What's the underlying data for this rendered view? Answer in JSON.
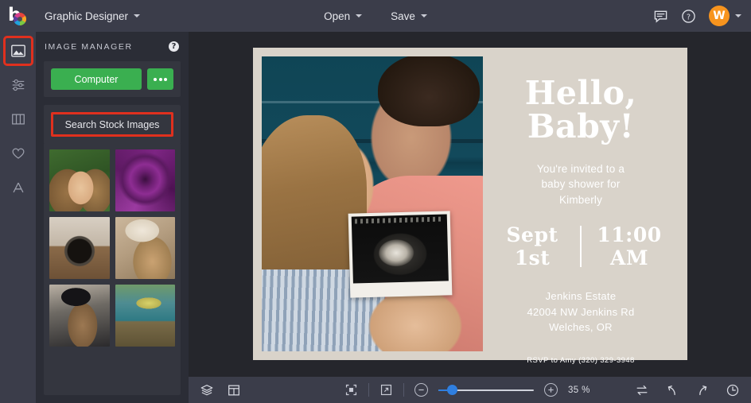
{
  "app": {
    "logo": "befunky-logo",
    "document_title": "Graphic Designer",
    "open_label": "Open",
    "save_label": "Save",
    "avatar_initial": "W",
    "accent_green": "#3aaf50",
    "accent_orange": "#f7941e",
    "highlight_red": "#e0301e",
    "accent_blue": "#2f7fe0"
  },
  "rail": {
    "items": [
      {
        "name": "image-manager",
        "icon": "image-icon",
        "active": true
      },
      {
        "name": "edit",
        "icon": "sliders-icon",
        "active": false
      },
      {
        "name": "templates",
        "icon": "columns-icon",
        "active": false
      },
      {
        "name": "favorites",
        "icon": "heart-icon",
        "active": false
      },
      {
        "name": "text",
        "icon": "text-a-icon",
        "active": false
      }
    ]
  },
  "panel": {
    "title": "IMAGE MANAGER",
    "help_icon": "question-icon",
    "computer_label": "Computer",
    "more_icon": "ellipsis-icon",
    "search_stock_label": "Search Stock Images",
    "thumbnails": [
      {
        "name": "thumb-woman-smiling",
        "class": "th1"
      },
      {
        "name": "thumb-purple-flower",
        "class": "th2"
      },
      {
        "name": "thumb-vintage-camera",
        "class": "th3"
      },
      {
        "name": "thumb-woman-hat-blonde",
        "class": "th4"
      },
      {
        "name": "thumb-woman-black-hat",
        "class": "th5"
      },
      {
        "name": "thumb-vintage-truck",
        "class": "th6"
      }
    ]
  },
  "canvas": {
    "card_bg": "#d9d3ca",
    "photo_alt": "couple-holding-ultrasound-photo",
    "headline_line1": "Hello,",
    "headline_line2": "Baby!",
    "invitation_text": "You're invited to a\nbaby shower for\nKimberly",
    "date_line1": "Sept",
    "date_line2": "1st",
    "time_line1": "11:00",
    "time_line2": "AM",
    "venue_line1": "Jenkins Estate",
    "venue_line2": "42004 NW Jenkins Rd",
    "venue_line3": "Welches, OR",
    "rsvp": "RSVP to Amy (320) 329-3948"
  },
  "bottombar": {
    "layers_icon": "layers-icon",
    "layout_icon": "layout-icon",
    "fit_icon": "fit-to-screen-icon",
    "expand_icon": "expand-icon",
    "zoom_out_icon": "minus-icon",
    "zoom_in_icon": "plus-icon",
    "zoom_level": "35 %",
    "zoom_slider_percent": 12,
    "compare_icon": "compare-swap-icon",
    "undo_icon": "undo-icon",
    "redo_icon": "redo-icon",
    "history_icon": "history-clock-icon"
  }
}
